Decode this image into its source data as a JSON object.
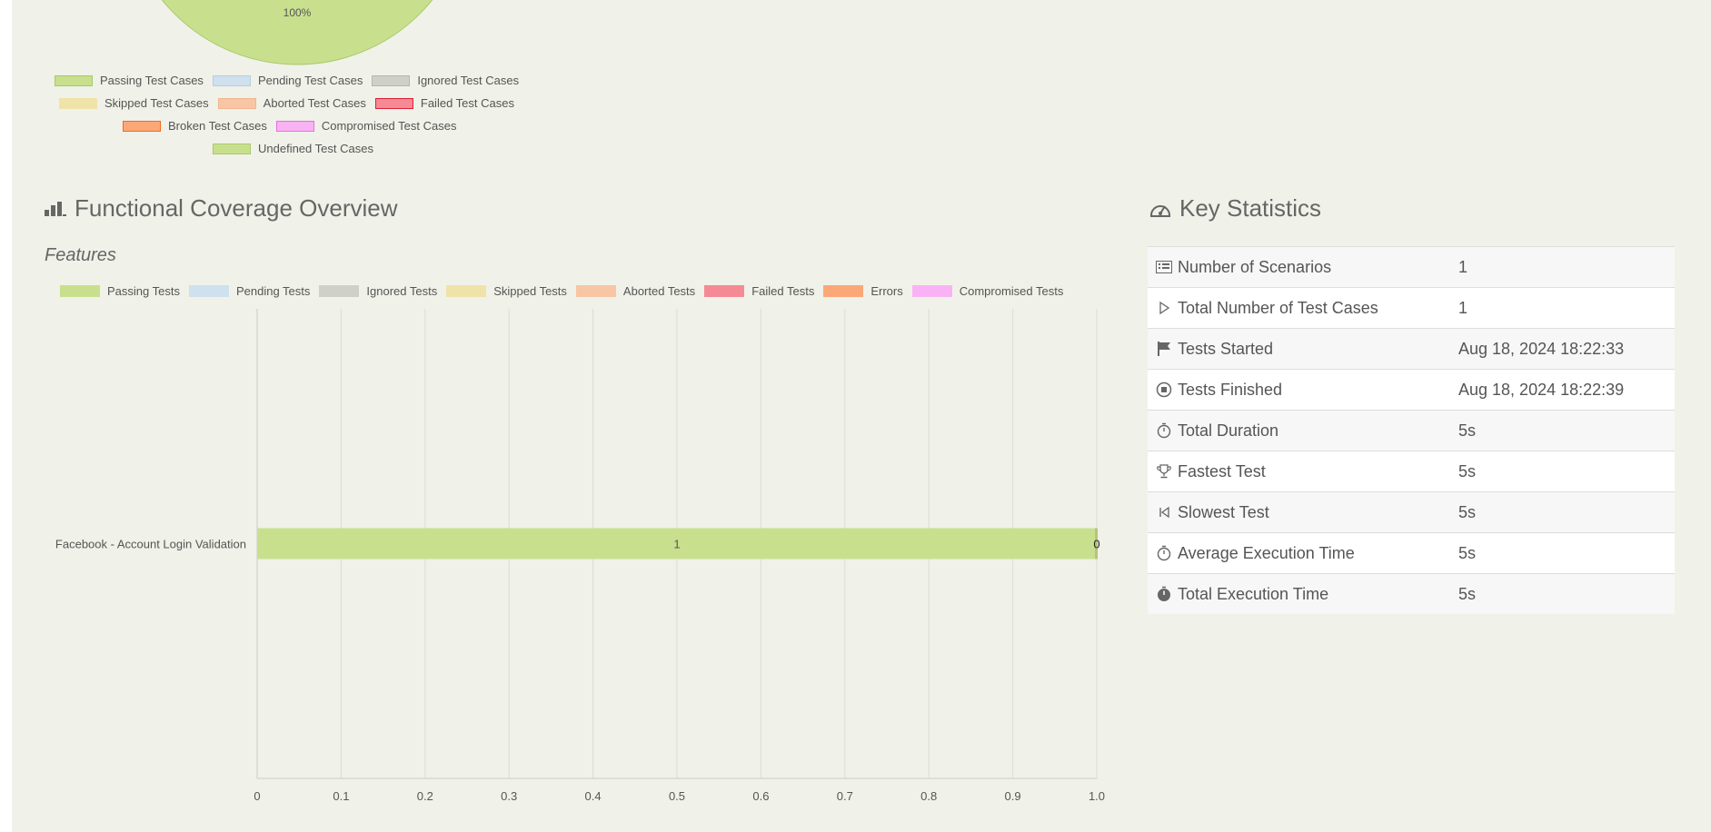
{
  "pie": {
    "label": "100%",
    "legend": [
      {
        "label": "Passing Test Cases",
        "fill": "#c8e08e",
        "border": "#a8c96a"
      },
      {
        "label": "Pending Test Cases",
        "fill": "#cfe0ee",
        "border": "#b8cde0"
      },
      {
        "label": "Ignored Test Cases",
        "fill": "#cfd0c8",
        "border": "#b5b6ae"
      },
      {
        "label": "Skipped Test Cases",
        "fill": "#f0e3a8",
        "border": "#f0e3a8"
      },
      {
        "label": "Aborted Test Cases",
        "fill": "#f8c6a4",
        "border": "#f0b690"
      },
      {
        "label": "Failed Test Cases",
        "fill": "#f58a95",
        "border": "#d8203a"
      },
      {
        "label": "Broken Test Cases",
        "fill": "#fba877",
        "border": "#f26b1d"
      },
      {
        "label": "Compromised Test Cases",
        "fill": "#f9b3f4",
        "border": "#e86ee0"
      },
      {
        "label": "Undefined Test Cases",
        "fill": "#c8e08e",
        "border": "#a8c96a"
      }
    ]
  },
  "coverage": {
    "title": "Functional Coverage Overview",
    "features_title": "Features"
  },
  "chart_data": {
    "type": "bar",
    "orientation": "horizontal",
    "stacked": true,
    "categories": [
      "Facebook - Account Login Validation"
    ],
    "series": [
      {
        "name": "Passing Tests",
        "values": [
          1
        ],
        "color": "#c8e08e",
        "label": "1"
      },
      {
        "name": "Pending Tests",
        "values": [
          0
        ],
        "color": "#cfe0ee"
      },
      {
        "name": "Ignored Tests",
        "values": [
          0
        ],
        "color": "#cfd0c8"
      },
      {
        "name": "Skipped Tests",
        "values": [
          0
        ],
        "color": "#f0e3a8"
      },
      {
        "name": "Aborted Tests",
        "values": [
          0
        ],
        "color": "#f8c6a4"
      },
      {
        "name": "Failed Tests",
        "values": [
          0
        ],
        "color": "#f58a95"
      },
      {
        "name": "Errors",
        "values": [
          0
        ],
        "color": "#fba877"
      },
      {
        "name": "Compromised Tests",
        "values": [
          0
        ],
        "color": "#f9b3f4"
      }
    ],
    "end_label": "0",
    "xlim": [
      0,
      1.0
    ],
    "xticks": [
      "0",
      "0.1",
      "0.2",
      "0.3",
      "0.4",
      "0.5",
      "0.6",
      "0.7",
      "0.8",
      "0.9",
      "1.0"
    ],
    "grid": true,
    "legend_position": "top"
  },
  "stats": {
    "title": "Key Statistics",
    "rows": [
      {
        "label": "Number of Scenarios",
        "value": "1",
        "icon": "list-icon"
      },
      {
        "label": "Total Number of Test Cases",
        "value": "1",
        "icon": "play-icon"
      },
      {
        "label": "Tests Started",
        "value": "Aug 18, 2024 18:22:33",
        "icon": "flag-icon"
      },
      {
        "label": "Tests Finished",
        "value": "Aug 18, 2024 18:22:39",
        "icon": "stop-circle-icon"
      },
      {
        "label": "Total Duration",
        "value": "5s",
        "icon": "stopwatch-icon"
      },
      {
        "label": "Fastest Test",
        "value": "5s",
        "icon": "trophy-icon"
      },
      {
        "label": "Slowest Test",
        "value": "5s",
        "icon": "skip-back-icon"
      },
      {
        "label": "Average Execution Time",
        "value": "5s",
        "icon": "stopwatch-icon"
      },
      {
        "label": "Total Execution Time",
        "value": "5s",
        "icon": "stopwatch-filled-icon"
      }
    ]
  }
}
